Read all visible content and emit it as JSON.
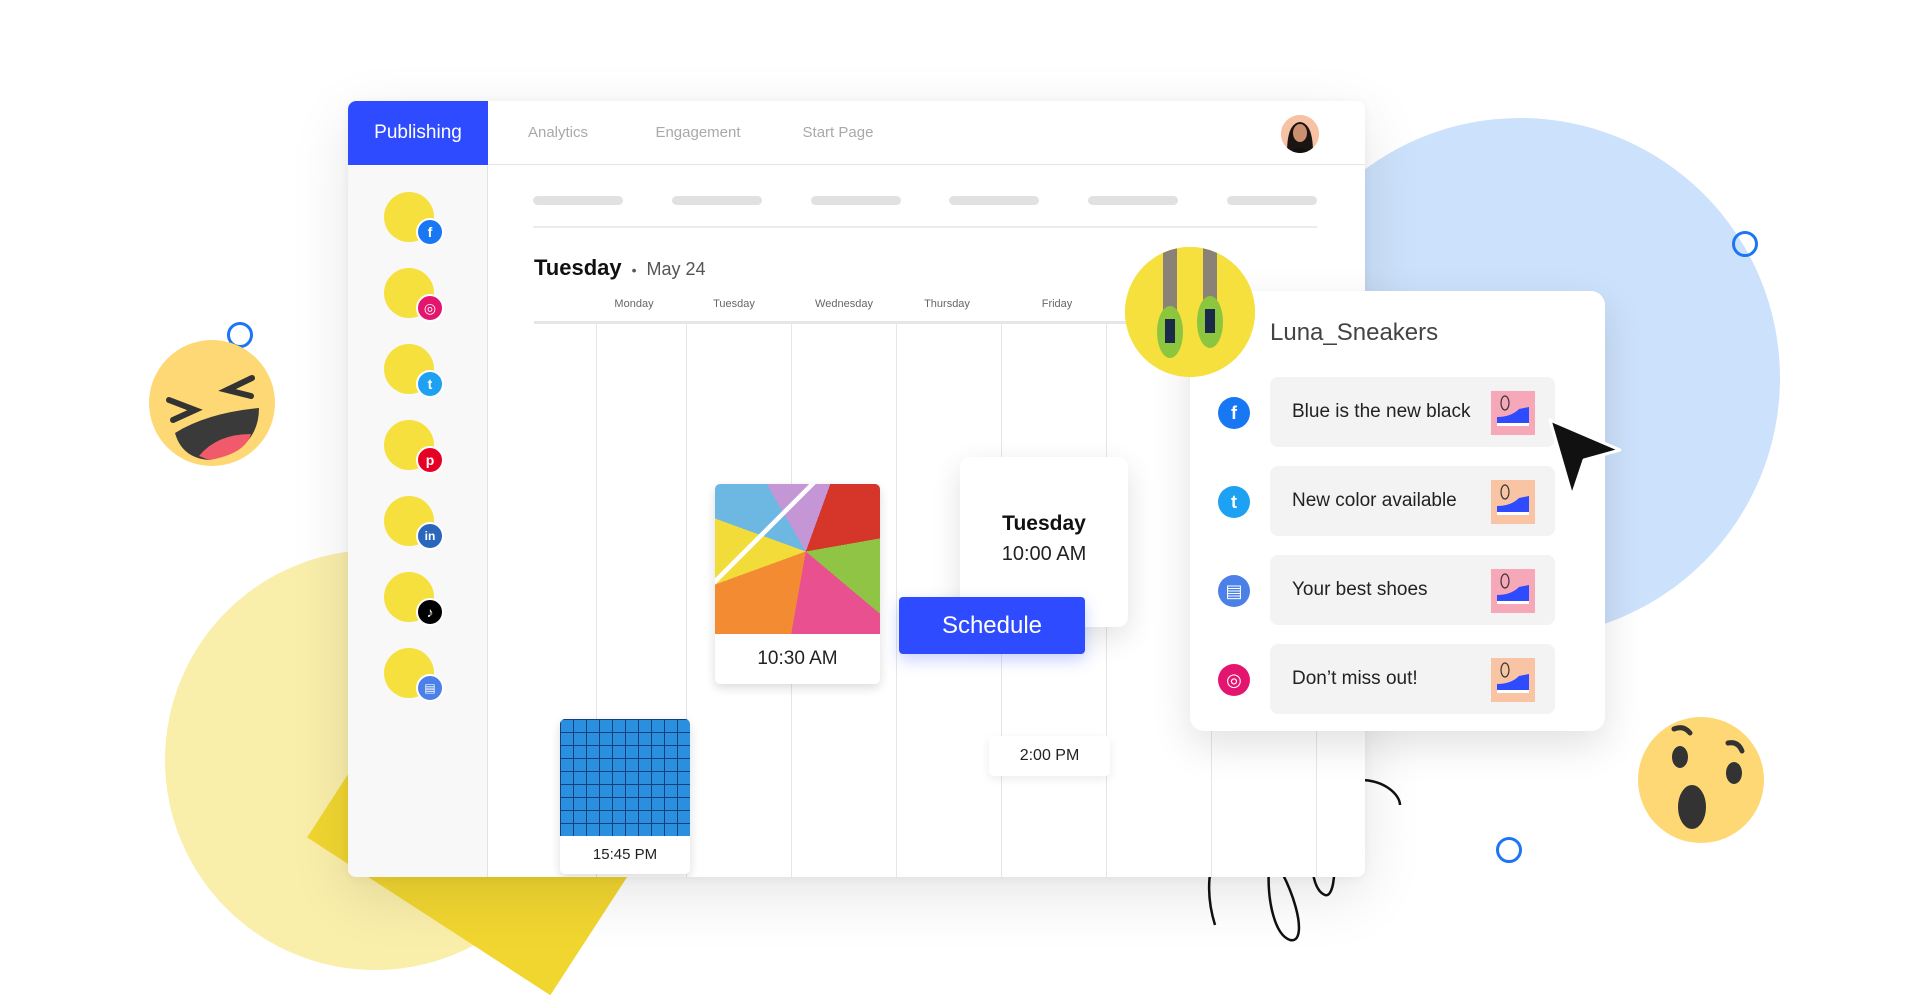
{
  "tabs": [
    {
      "label": "Publishing",
      "active": true
    },
    {
      "label": "Analytics",
      "active": false
    },
    {
      "label": "Engagement",
      "active": false
    },
    {
      "label": "Start Page",
      "active": false
    }
  ],
  "user_avatar": "user-avatar",
  "sidebar": {
    "accounts": [
      {
        "network": "facebook",
        "color": "#1877f2",
        "glyph": "f"
      },
      {
        "network": "instagram",
        "color": "#e4156e",
        "glyph": "◎"
      },
      {
        "network": "twitter",
        "color": "#1da1f2",
        "glyph": "t"
      },
      {
        "network": "pinterest",
        "color": "#e60023",
        "glyph": "p"
      },
      {
        "network": "linkedin",
        "color": "#2a66bc",
        "glyph": "in"
      },
      {
        "network": "tiktok",
        "color": "#000000",
        "glyph": "♪"
      },
      {
        "network": "google-business",
        "color": "#4a80e8",
        "glyph": "▤"
      }
    ]
  },
  "calendar": {
    "day_name": "Tuesday",
    "separator": "•",
    "date": "May 24",
    "weekdays": [
      "Monday",
      "Tuesday",
      "Wednesday",
      "Thursday",
      "Friday"
    ],
    "posts": [
      {
        "time": "10:30 AM",
        "image": "sneakers-colorful-floor"
      },
      {
        "time": "15:45 PM",
        "image": "white-sneakers-blue-grid"
      },
      {
        "time": "2:00 PM"
      }
    ]
  },
  "schedule_card": {
    "day": "Tuesday",
    "time": "10:00 AM",
    "button_label": "Schedule"
  },
  "panel": {
    "account_name": "Luna_Sneakers",
    "items": [
      {
        "network": "facebook",
        "color": "#1877f2",
        "glyph": "f",
        "text": "Blue is the new black",
        "thumb_bg": "#f7a8b8"
      },
      {
        "network": "twitter",
        "color": "#1da1f2",
        "glyph": "t",
        "text": "New color available",
        "thumb_bg": "#f9c4a4"
      },
      {
        "network": "google-business",
        "color": "#4a80e8",
        "glyph": "▤",
        "text": "Your best shoes",
        "thumb_bg": "#f7a8b8"
      },
      {
        "network": "instagram",
        "color": "#e4156e",
        "glyph": "◎",
        "text": "Don’t miss out!",
        "thumb_bg": "#f9c4a4"
      }
    ]
  },
  "colors": {
    "accent": "#2f4bff",
    "blob_blue": "#cce1fb",
    "blob_yellow": "#f9eeaa",
    "ring": "#1d74f5"
  }
}
